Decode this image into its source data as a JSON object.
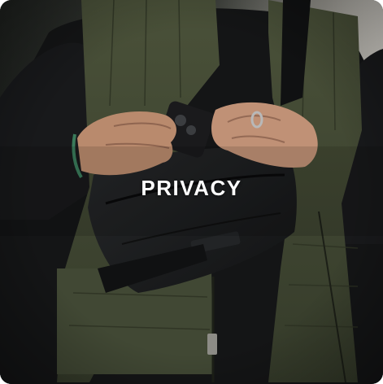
{
  "card": {
    "caption": "PRIVACY"
  },
  "colors": {
    "caption_text": "#ffffff",
    "background_sky": "#d9d6cf",
    "vest_olive": "#3f4632",
    "sweater_black": "#141516",
    "bag_black": "#1b1c1e",
    "skin": "#b98a6d"
  }
}
